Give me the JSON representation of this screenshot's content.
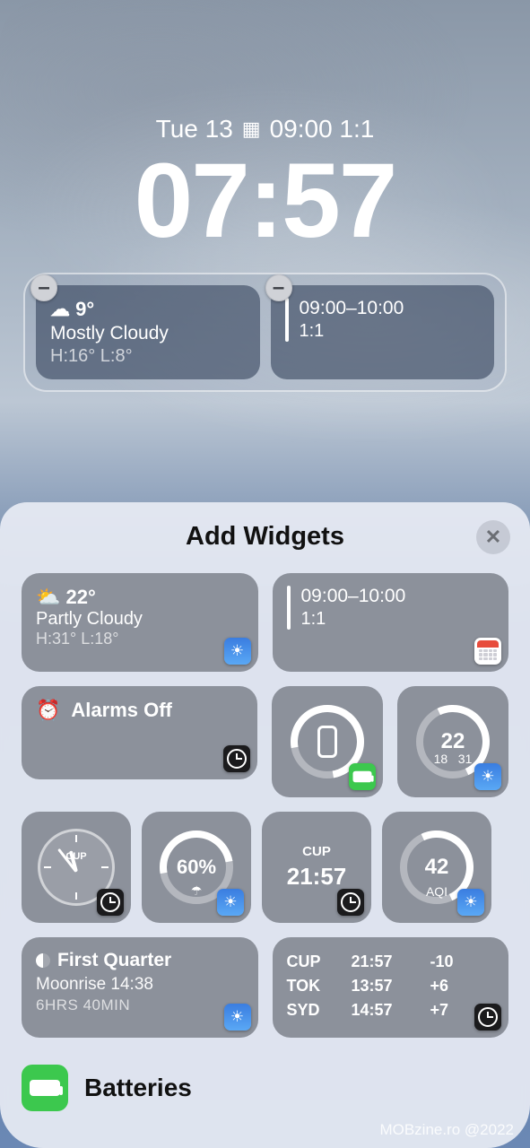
{
  "lockscreen": {
    "date": "Tue 13",
    "inline_event": "09:00 1:1",
    "time": "07:57",
    "weather": {
      "icon": "cloud",
      "temp": "9°",
      "condition": "Mostly Cloudy",
      "high_low": "H:16° L:8°"
    },
    "calendar": {
      "time_range": "09:00–10:00",
      "title": "1:1"
    }
  },
  "sheet": {
    "title": "Add Widgets",
    "widgets": {
      "weather_large": {
        "temp": "22°",
        "condition": "Partly Cloudy",
        "high_low": "H:31° L:18°",
        "app": "Weather"
      },
      "calendar_large": {
        "time_range": "09:00–10:00",
        "title": "1:1",
        "app": "Calendar"
      },
      "alarms": {
        "label": "Alarms Off",
        "app": "Clock"
      },
      "battery_ring": {
        "device": "phone",
        "app": "Batteries"
      },
      "temp_ring": {
        "value": "22",
        "low": "18",
        "high": "31",
        "app": "Weather"
      },
      "clock_analog": {
        "city": "CUP",
        "app": "Clock"
      },
      "precip_ring": {
        "value": "60%",
        "icon": "umbrella",
        "app": "Weather"
      },
      "city_time": {
        "city": "CUP",
        "time": "21:57",
        "app": "Clock"
      },
      "aqi_ring": {
        "value": "42",
        "label": "AQI",
        "app": "Weather"
      },
      "moon": {
        "phase": "First Quarter",
        "moonrise": "Moonrise 14:38",
        "duration": "6HRS 40MIN",
        "app": "Weather"
      },
      "world_clock": {
        "rows": [
          {
            "city": "CUP",
            "time": "21:57",
            "offset": "-10"
          },
          {
            "city": "TOK",
            "time": "13:57",
            "offset": "+6"
          },
          {
            "city": "SYD",
            "time": "14:57",
            "offset": "+7"
          }
        ],
        "app": "Clock"
      }
    },
    "categories": [
      {
        "name": "Batteries",
        "icon": "battery"
      }
    ]
  },
  "watermark": "MOBzine.ro @2022"
}
